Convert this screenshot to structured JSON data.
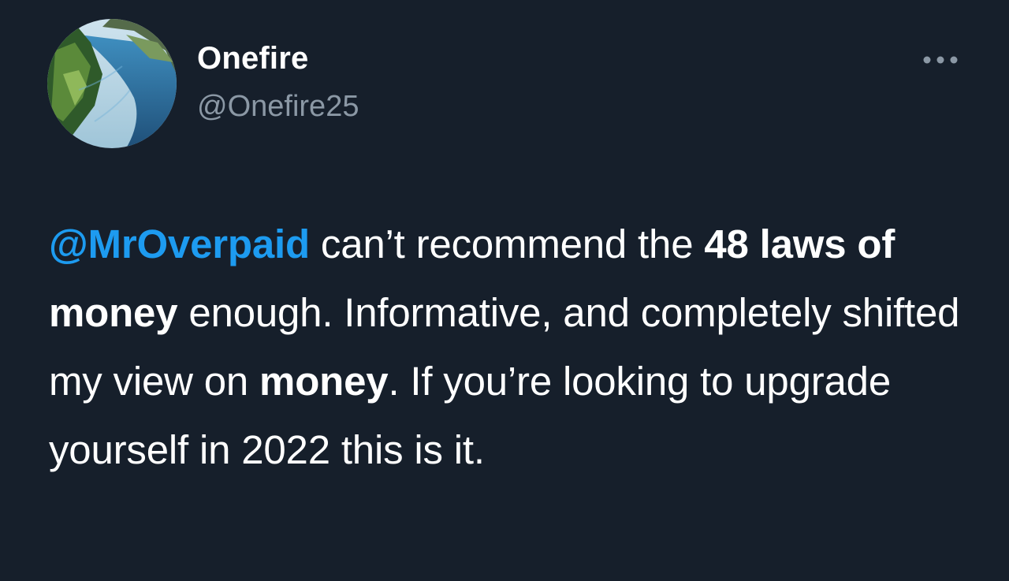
{
  "tweet": {
    "author": {
      "display_name": "Onefire",
      "handle": "@Onefire25",
      "avatar_icon": "fjord-landscape-avatar"
    },
    "more_icon": "more-horizontal-icon",
    "text": {
      "mention": "@MrOverpaid",
      "seg1": " can’t recommend the ",
      "bold1": "48 laws of money",
      "seg2": " enough. Informative, and completely shifted my view on ",
      "bold2": "money",
      "seg3": ". If you’re looking to upgrade yourself in 2022 this is it."
    }
  },
  "colors": {
    "background": "#161f2b",
    "text": "#ffffff",
    "secondary_text": "#8b98a5",
    "mention": "#1d9bf0"
  }
}
